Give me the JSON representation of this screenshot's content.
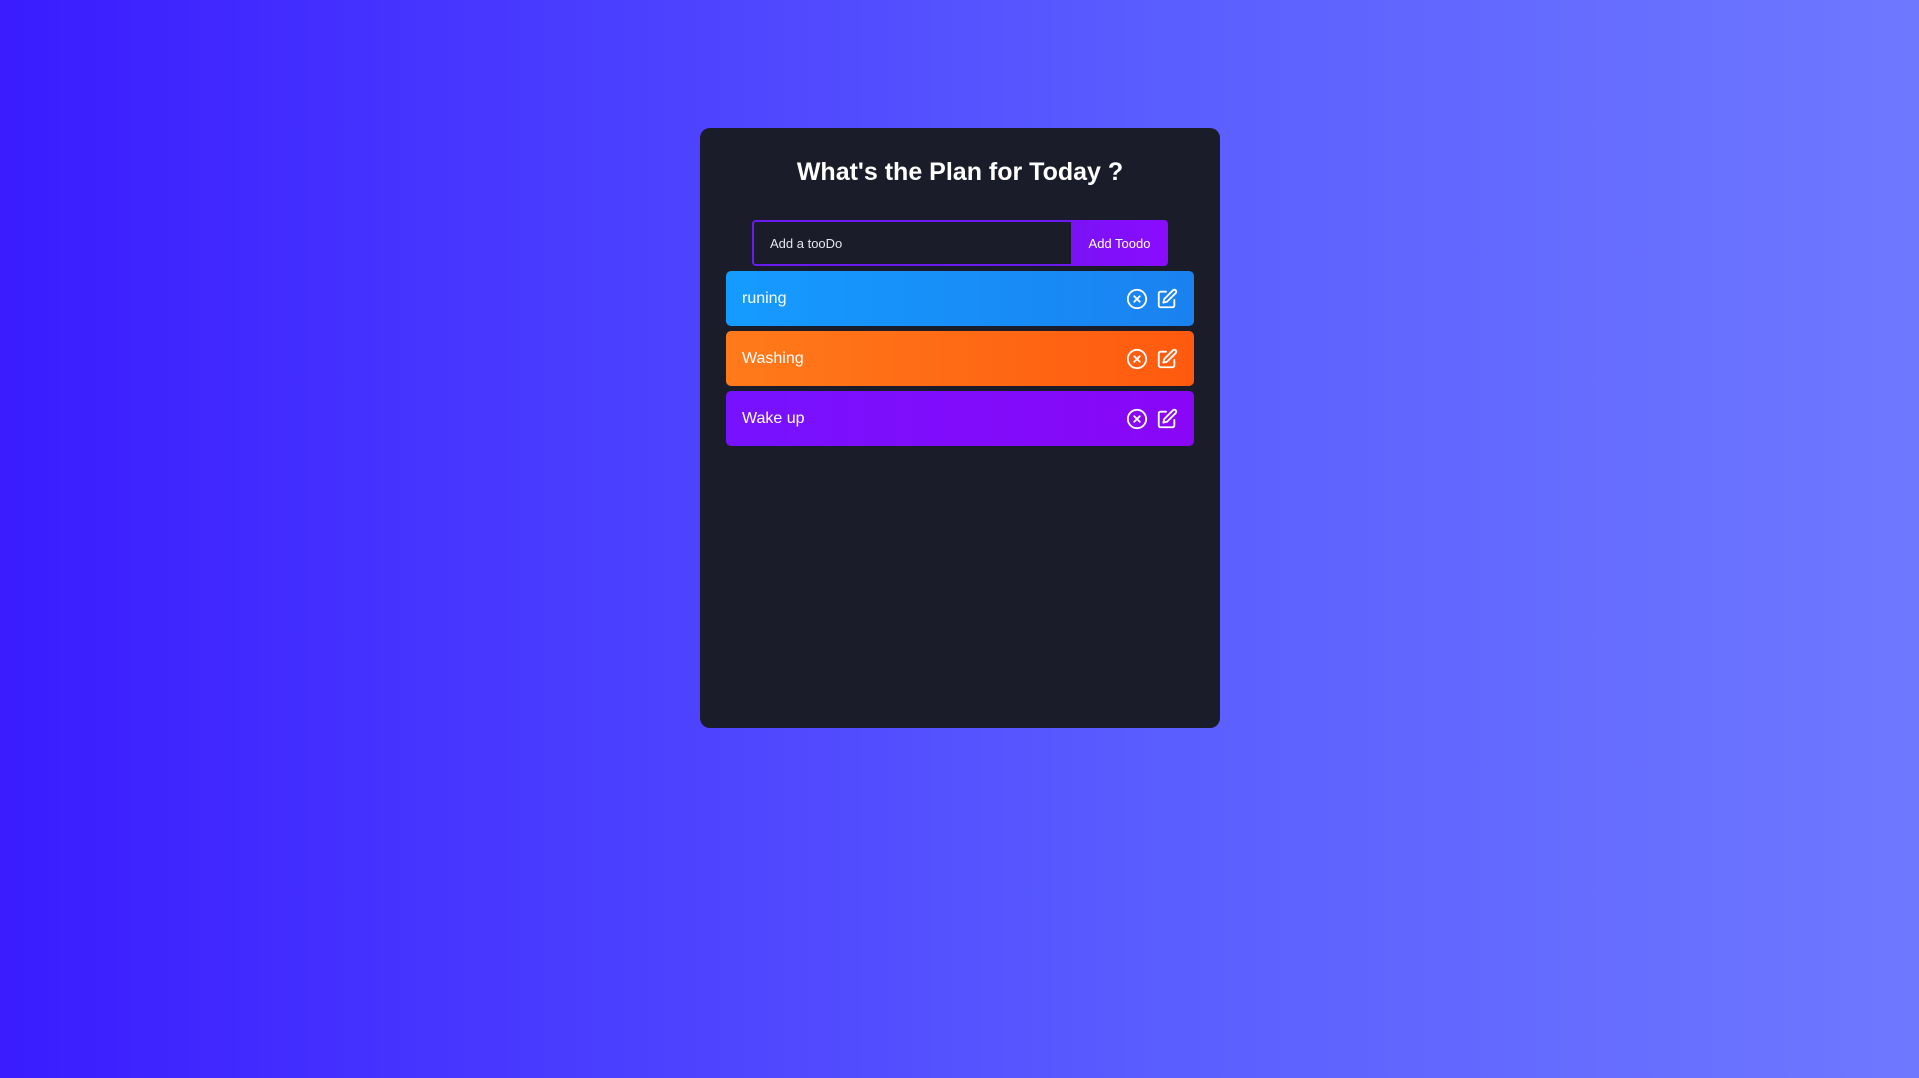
{
  "header": {
    "title": "What's the Plan for Today ?"
  },
  "form": {
    "input_placeholder": "Add a tooDo",
    "input_value": "",
    "add_button_label": "Add Toodo"
  },
  "todos": [
    {
      "text": "runing",
      "color": "#159bff",
      "delete_icon": "close-circle-icon",
      "edit_icon": "edit-icon"
    },
    {
      "text": "Washing",
      "color": "#ff6a14",
      "delete_icon": "close-circle-icon",
      "edit_icon": "edit-icon"
    },
    {
      "text": "Wake up",
      "color": "#7f0cfb",
      "delete_icon": "close-circle-icon",
      "edit_icon": "edit-icon"
    }
  ]
}
